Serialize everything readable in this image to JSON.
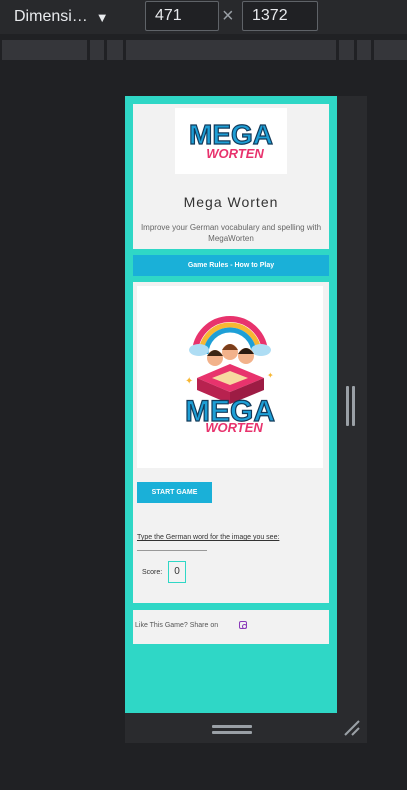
{
  "devtools": {
    "device": "Dimensi…",
    "width": "471",
    "height": "1372"
  },
  "site": {
    "logo_line1": "MEGA",
    "logo_line2": "WORTEN",
    "title": "Mega Worten",
    "description": "Improve your German vocabulary and spelling with MegaWorten",
    "rules_button": "Game Rules - How to Play"
  },
  "game": {
    "start_button": "START GAME",
    "prompt": "Type the German word for the image you see:",
    "answer_value": "",
    "score_label": "Score:",
    "score_value": "0"
  },
  "share": {
    "text": "Like This Game? Share on",
    "icon": "instagram-icon"
  },
  "colors": {
    "accent": "#2fd7c6",
    "button": "#1ab0d8",
    "logo_blue": "#1e9fd6",
    "logo_pink": "#e8336d"
  }
}
